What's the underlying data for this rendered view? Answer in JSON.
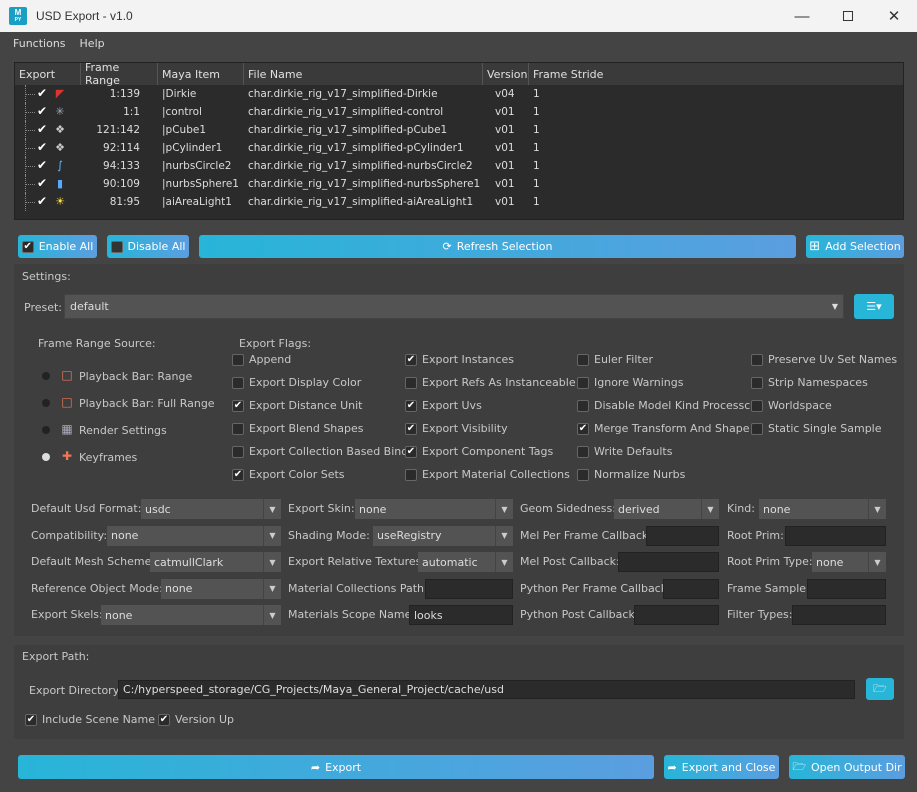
{
  "window": {
    "title": "USD Export - v1.0",
    "icon_text": "M",
    "icon_sub": "PY"
  },
  "menu": [
    "Functions",
    "Help"
  ],
  "table": {
    "headers": [
      "Export",
      "Frame Range",
      "Maya Item",
      "File Name",
      "Version",
      "Frame Stride"
    ],
    "rows": [
      {
        "check": "✔",
        "icon": "rig-icon",
        "frame_range": "1:139",
        "maya_item": "|Dirkie",
        "file_name": "char.dirkie_rig_v17_simplified-Dirkie",
        "version": "v04",
        "stride": "1"
      },
      {
        "check": "✔",
        "icon": "control-icon",
        "frame_range": "1:1",
        "maya_item": "|control",
        "file_name": "char.dirkie_rig_v17_simplified-control",
        "version": "v01",
        "stride": "1"
      },
      {
        "check": "✔",
        "icon": "cube-icon",
        "frame_range": "121:142",
        "maya_item": "|pCube1",
        "file_name": "char.dirkie_rig_v17_simplified-pCube1",
        "version": "v01",
        "stride": "1"
      },
      {
        "check": "✔",
        "icon": "cylinder-icon",
        "frame_range": "92:114",
        "maya_item": "|pCylinder1",
        "file_name": "char.dirkie_rig_v17_simplified-pCylinder1",
        "version": "v01",
        "stride": "1"
      },
      {
        "check": "✔",
        "icon": "curve-icon",
        "frame_range": "94:133",
        "maya_item": "|nurbsCircle2",
        "file_name": "char.dirkie_rig_v17_simplified-nurbsCircle2",
        "version": "v01",
        "stride": "1"
      },
      {
        "check": "✔",
        "icon": "nurbs-sphere-icon",
        "frame_range": "90:109",
        "maya_item": "|nurbsSphere1",
        "file_name": "char.dirkie_rig_v17_simplified-nurbsSphere1",
        "version": "v01",
        "stride": "1"
      },
      {
        "check": "✔",
        "icon": "light-icon",
        "frame_range": "81:95",
        "maya_item": "|aiAreaLight1",
        "file_name": "char.dirkie_rig_v17_simplified-aiAreaLight1",
        "version": "v01",
        "stride": "1"
      }
    ]
  },
  "buttons": {
    "enable_all": "Enable All",
    "disable_all": "Disable All",
    "refresh": "Refresh Selection",
    "add_selection": "Add Selection",
    "export": "Export",
    "export_close": "Export and Close",
    "open_output": "Open Output Dir"
  },
  "settings": {
    "title": "Settings:",
    "preset_label": "Preset:",
    "preset_value": "default",
    "frame_range_source_label": "Frame Range Source:",
    "sources": [
      {
        "label": "Playback Bar: Range",
        "selected": false
      },
      {
        "label": "Playback Bar: Full Range",
        "selected": false
      },
      {
        "label": "Render Settings",
        "selected": false
      },
      {
        "label": "Keyframes",
        "selected": true
      }
    ],
    "export_flags_label": "Export Flags:",
    "flags": [
      [
        "Append",
        false
      ],
      [
        "Export Display Color",
        false
      ],
      [
        "Export Distance Unit",
        true
      ],
      [
        "Export Blend Shapes",
        false
      ],
      [
        "Export Collection Based Bind",
        false
      ],
      [
        "Export Color Sets",
        true
      ],
      [
        "Export Instances",
        true
      ],
      [
        "Export Refs As Instanceable",
        false
      ],
      [
        "Export Uvs",
        true
      ],
      [
        "Export Visibility",
        true
      ],
      [
        "Export Component Tags",
        true
      ],
      [
        "Export Material Collections",
        false
      ],
      [
        "Euler Filter",
        false
      ],
      [
        "Ignore Warnings",
        false
      ],
      [
        "Disable Model Kind Processc",
        false
      ],
      [
        "Merge Transform And Shape",
        true
      ],
      [
        "Write Defaults",
        false
      ],
      [
        "Normalize Nurbs",
        false
      ],
      [
        "Preserve Uv Set Names",
        false
      ],
      [
        "Strip Namespaces",
        false
      ],
      [
        "Worldspace",
        false
      ],
      [
        "Static Single Sample",
        false
      ]
    ],
    "options": {
      "default_usd_format": {
        "label": "Default Usd Format:",
        "value": "usdc"
      },
      "compatibility": {
        "label": "Compatibility:",
        "value": "none"
      },
      "default_mesh_scheme": {
        "label": "Default Mesh Scheme:",
        "value": "catmullClark"
      },
      "reference_object_mode": {
        "label": "Reference Object Mode:",
        "value": "none"
      },
      "export_skels": {
        "label": "Export Skels:",
        "value": "none"
      },
      "export_skin": {
        "label": "Export Skin:",
        "value": "none"
      },
      "shading_mode": {
        "label": "Shading Mode:",
        "value": "useRegistry"
      },
      "export_relative_textures": {
        "label": "Export Relative Textures:",
        "value": "automatic"
      },
      "material_collections_path": {
        "label": "Material Collections Path:",
        "value": ""
      },
      "materials_scope_name": {
        "label": "Materials Scope Name:",
        "value": "looks"
      },
      "geom_sidedness": {
        "label": "Geom Sidedness:",
        "value": "derived"
      },
      "mel_per_frame_callback": {
        "label": "Mel Per Frame Callback:",
        "value": ""
      },
      "mel_post_callback": {
        "label": "Mel Post Callback:",
        "value": ""
      },
      "python_per_frame_callback": {
        "label": "Python Per Frame Callback:",
        "value": ""
      },
      "python_post_callback": {
        "label": "Python Post Callback:",
        "value": ""
      },
      "kind": {
        "label": "Kind:",
        "value": "none"
      },
      "root_prim": {
        "label": "Root Prim:",
        "value": ""
      },
      "root_prim_type": {
        "label": "Root Prim Type:",
        "value": "none"
      },
      "frame_sample": {
        "label": "Frame Sample:",
        "value": ""
      },
      "filter_types": {
        "label": "Filter Types:",
        "value": ""
      }
    }
  },
  "export_path": {
    "title": "Export Path:",
    "dir_label": "Export Directory:",
    "dir_value": "C:/hyperspeed_storage/CG_Projects/Maya_General_Project/cache/usd",
    "include_scene_name": "Include Scene Name",
    "version_up": "Version Up"
  },
  "colors": {
    "accent": "#27b5d8",
    "accent2": "#5b9ee0",
    "panel": "#3e3e3e",
    "bg": "#444444"
  }
}
